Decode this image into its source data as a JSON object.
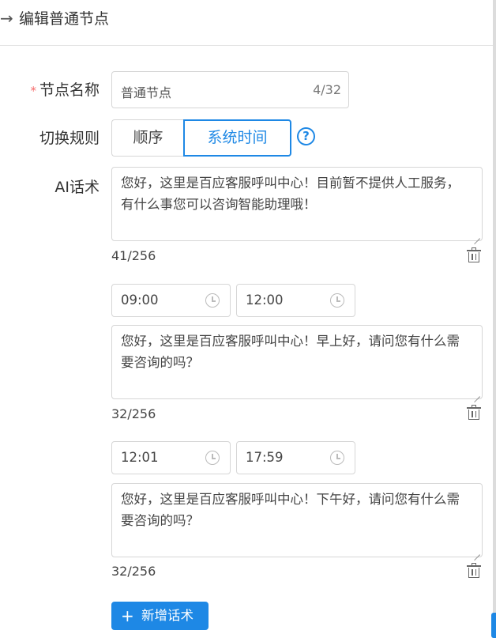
{
  "header": {
    "back_icon": "arrow-right-icon",
    "title": "编辑普通节点"
  },
  "form": {
    "node_name": {
      "label": "节点名称",
      "required_mark": "*",
      "value": "普通节点",
      "count": "4/32"
    },
    "switch_rule": {
      "label": "切换规则",
      "options": [
        "顺序",
        "系统时间"
      ],
      "selected": "系统时间",
      "help_icon": "question-circle-icon",
      "help_glyph": "?"
    },
    "ai_script": {
      "label": "AI话术",
      "default_text": "您好，这里是百应客服呼叫中心！目前暂不提供人工服务，有什么事您可以咨询智能助理哦！",
      "default_count": "41/256",
      "slots": [
        {
          "start": "09:00",
          "end": "12:00",
          "text": "您好，这里是百应客服呼叫中心！早上好，请问您有什么需要咨询的吗？",
          "count": "32/256"
        },
        {
          "start": "12:01",
          "end": "17:59",
          "text": "您好，这里是百应客服呼叫中心！下午好，请问您有什么需要咨询的吗？",
          "count": "32/256"
        }
      ]
    },
    "add_button": {
      "icon": "plus-icon",
      "plus_glyph": "+",
      "label": "新增话术"
    }
  },
  "colors": {
    "primary": "#1e88e5",
    "required": "#f56c6c",
    "border": "#d6d6d6"
  }
}
